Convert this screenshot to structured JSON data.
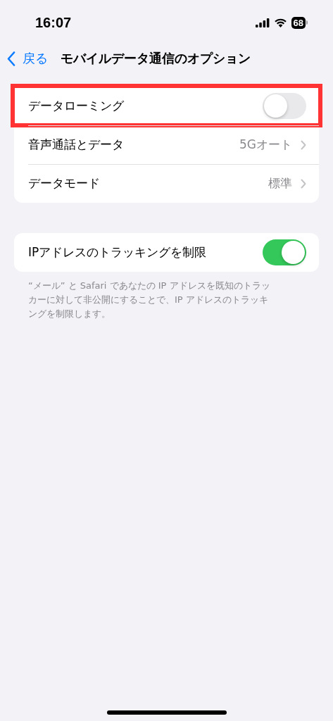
{
  "status_bar": {
    "time": "16:07",
    "battery": "68"
  },
  "nav": {
    "back": "戻る",
    "title": "モバイルデータ通信のオプション"
  },
  "groups": [
    {
      "rows": [
        {
          "kind": "toggle",
          "label": "データローミング",
          "on": false,
          "highlighted": true
        },
        {
          "kind": "link",
          "label": "音声通話とデータ",
          "value": "5Gオート"
        },
        {
          "kind": "link",
          "label": "データモード",
          "value": "標準"
        }
      ]
    },
    {
      "rows": [
        {
          "kind": "toggle",
          "label": "IPアドレスのトラッキングを制限",
          "on": true,
          "highlighted": false
        }
      ],
      "footer": "“メール” と Safari であなたの IP アドレスを既知のトラッカーに対して非公開にすることで、IP アドレスのトラッキングを制限します。"
    }
  ]
}
